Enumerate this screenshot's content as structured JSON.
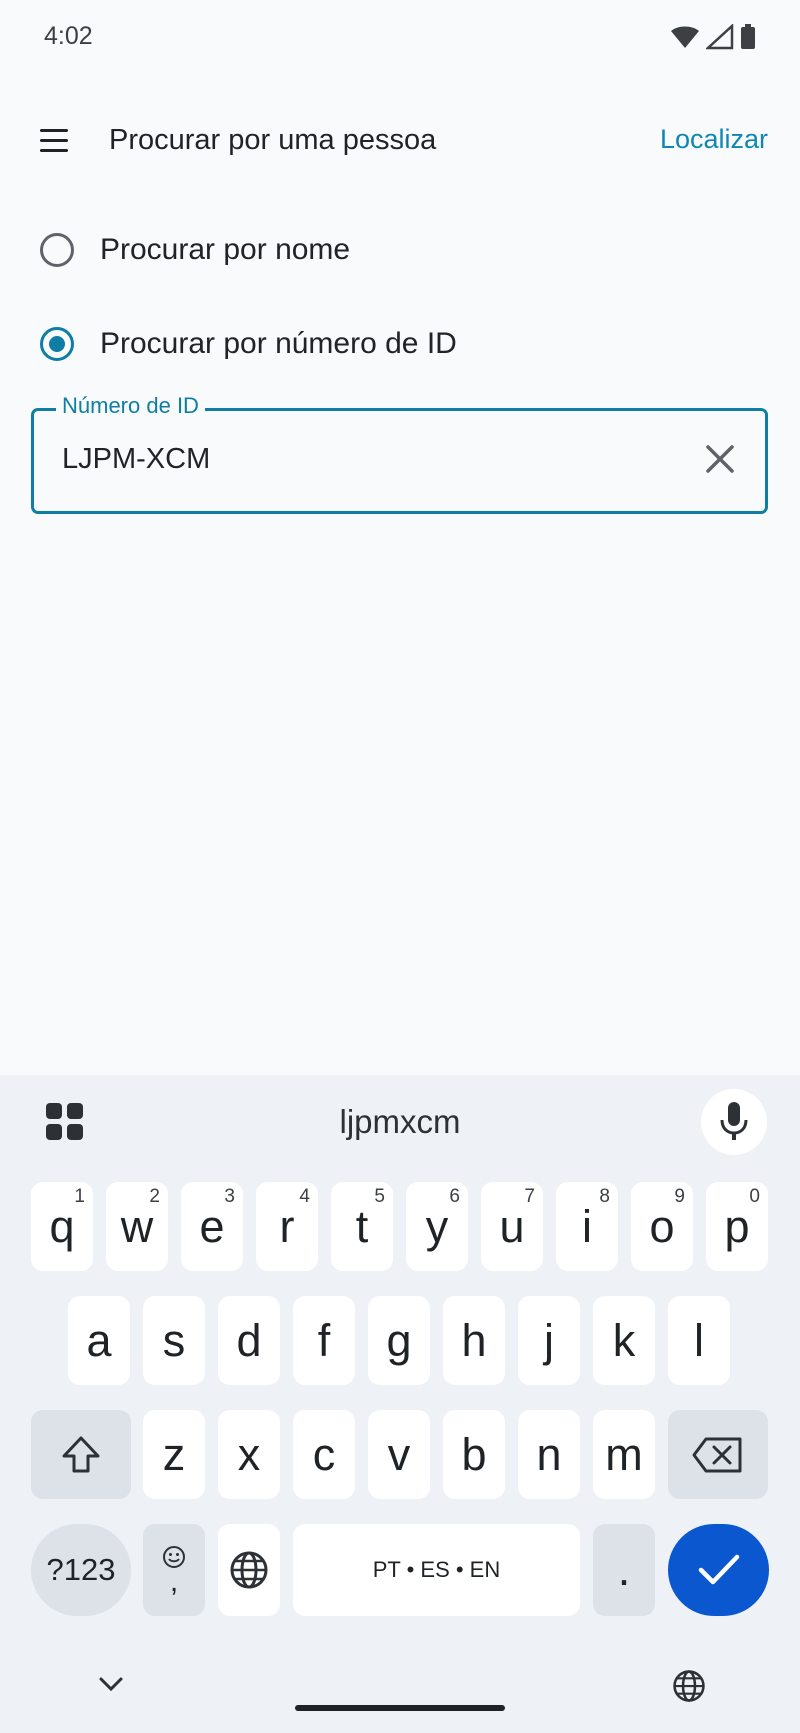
{
  "status": {
    "time": "4:02"
  },
  "appbar": {
    "title": "Procurar por uma pessoa",
    "action": "Localizar"
  },
  "options": [
    {
      "label": "Procurar por nome",
      "selected": false
    },
    {
      "label": "Procurar por número de ID",
      "selected": true
    }
  ],
  "id_field": {
    "label": "Número de ID",
    "value": "LJPM-XCM"
  },
  "keyboard": {
    "suggestion": "ljpmxcm",
    "row1": [
      {
        "k": "q",
        "s": "1"
      },
      {
        "k": "w",
        "s": "2"
      },
      {
        "k": "e",
        "s": "3"
      },
      {
        "k": "r",
        "s": "4"
      },
      {
        "k": "t",
        "s": "5"
      },
      {
        "k": "y",
        "s": "6"
      },
      {
        "k": "u",
        "s": "7"
      },
      {
        "k": "i",
        "s": "8"
      },
      {
        "k": "o",
        "s": "9"
      },
      {
        "k": "p",
        "s": "0"
      }
    ],
    "row2": [
      "a",
      "s",
      "d",
      "f",
      "g",
      "h",
      "j",
      "k",
      "l"
    ],
    "row3": [
      "z",
      "x",
      "c",
      "v",
      "b",
      "n",
      "m"
    ],
    "symbols_label": "?123",
    "emoji_comma": ",",
    "space_label": "PT • ES • EN",
    "period": "."
  },
  "colors": {
    "accent": "#0f7ea4",
    "enter": "#0b57d0",
    "keyboard_bg": "#eef1f6"
  }
}
